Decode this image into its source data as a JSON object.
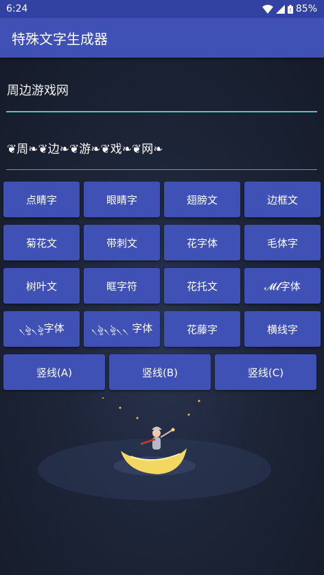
{
  "status": {
    "time": "6:24",
    "battery": "85%"
  },
  "appbar": {
    "title": "特殊文字生成器"
  },
  "input": {
    "value": "周边游戏网"
  },
  "output": {
    "value": "❦周❧❦边❧❦游❧❦戏❧❦网❧"
  },
  "buttons": {
    "row1": [
      "点睛字",
      "眼睛字",
      "翅膀文",
      "边框文"
    ],
    "row2": [
      "菊花文",
      "带刺文",
      "花字体",
      "毛体字"
    ],
    "row3": [
      "树叶文",
      "眶字符",
      "花托文",
      "𝓜𝓵字体"
    ],
    "row4": [
      "৲ৡ৲ৡ字体",
      "৲ৡ৲ৡ৲৲ 字体",
      "花藤字",
      "横线字"
    ],
    "row5": [
      "竖线(A)",
      "竖线(B)",
      "竖线(C)"
    ]
  },
  "colors": {
    "primary": "#3f51b5",
    "statusbar": "#3242a3",
    "accent": "#5bc6c1"
  }
}
